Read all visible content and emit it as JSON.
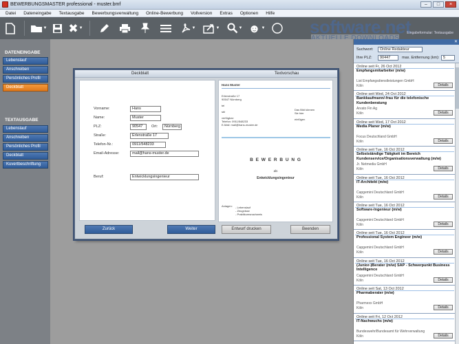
{
  "window": {
    "title": "BEWERBUNGSMASTER professional - muster.bmf"
  },
  "menu": [
    "Datei",
    "Dateneingabe",
    "Textausgabe",
    "Bewerbungsverwaltung",
    "Online-Bewerbung",
    "Vollversion",
    "Extras",
    "Optionen",
    "Hilfe"
  ],
  "watermark": {
    "big": "software.net",
    "small": "AKTUELLE DOWNLOADS",
    "sub": "Eingabeformular: Textausgabe"
  },
  "sidebar": {
    "section1": "DATENEINGABE",
    "items1": [
      "Lebenslauf",
      "Anschreiben",
      "Persönliches Profil",
      "Deckblatt"
    ],
    "section2": "TEXTAUSGABE",
    "items2": [
      "Lebenslauf",
      "Anschreiben",
      "Persönliches Profil",
      "Deckblatt",
      "Kuvertbeschriftung"
    ]
  },
  "dialog": {
    "tab_left": "Deckblatt",
    "tab_right": "Textvorschau",
    "fields": {
      "vorname_label": "Vorname:",
      "vorname": "Hans",
      "name_label": "Name:",
      "name": "Muster",
      "plz_label": "PLZ:",
      "plz": "90547",
      "ort_label": "Ort:",
      "ort": "Nürnberg",
      "strasse_label": "Straße:",
      "strasse": "Erlenstraße 17",
      "telefon_label": "Telefon-Nr.:",
      "telefon": "0911/548233",
      "email_label": "Email-Adresse:",
      "email": "mail@hans-muster.de",
      "beruf_label": "Beruf:",
      "beruf": "Entwicklungsingenieur"
    },
    "preview": {
      "name": "Hans Muster",
      "addr1": "Erlenstraße 17",
      "addr2": "90547 Nürnberg",
      "addr3": "tel",
      "addr4": "sbl",
      "addr5": "verfügbar:",
      "addr6": "Telefon: 0911/548233",
      "addr7": "E-Mail: mail@hans-muster.de",
      "photo1": "Das Bild können",
      "photo2": "Sie hier",
      "photo3": "einfügen",
      "title": "B E W E R B U N G",
      "als": "als",
      "job": "Entwicklungsingenieur",
      "anlagen": "Anlagen:",
      "anl1": "- Lebenslauf",
      "anl2": "- Zeugnisse",
      "anl3": "- Praktikumsnachweis"
    },
    "buttons": {
      "back": "Zurück",
      "next": "Weiter",
      "print": "Entwurf drucken",
      "close": "Beenden"
    }
  },
  "search": {
    "label1": "Suchwort:",
    "value1": "Online Redakteur",
    "label2": "Ihre PLZ:",
    "value2": "90447",
    "label3": "max. Entfernung (km):",
    "value3": "5"
  },
  "jobs": [
    {
      "date": "Online seit Fr, 26 Oct 2012",
      "title": "Empfangsmitarbeiter (m/w)",
      "company": "List Empfangsdienstleistungen GmbH",
      "loc": "Köln",
      "btn": "Details"
    },
    {
      "date": "Online seit Wed, 24 Oct 2012",
      "title": "Bankkaufmann/-frau für die telefonische Kundenberatung",
      "company": "Arvato Fin Ag",
      "loc": "Köln",
      "btn": "Details"
    },
    {
      "date": "Online seit Wed, 17 Oct 2012",
      "title": "Media Planer (m/w)",
      "company": "Focus Deutschland GmbH",
      "loc": "Köln",
      "btn": "Details"
    },
    {
      "date": "Online seit Tue, 16 Oct 2012",
      "title": "Selbstständige Tätigkeit im Bereich Kundenservice/Organisationsverwaltung (m/w)",
      "company": "Jr. Netmedia GmbH",
      "loc": "Köln",
      "btn": "Details"
    },
    {
      "date": "Online seit Tue, 16 Oct 2012",
      "title": "IT-Architekt (m/w)",
      "company": "Capgemini Deutschland GmbH",
      "loc": "Köln",
      "btn": "Details"
    },
    {
      "date": "Online seit Tue, 16 Oct 2012",
      "title": "Software-Ingenieur (m/w)",
      "company": "Capgemini Deutschland GmbH",
      "loc": "Köln",
      "btn": "Details"
    },
    {
      "date": "Online seit Tue, 16 Oct 2012",
      "title": "Professional System Engineer (m/w)",
      "company": "Capgemini Deutschland GmbH",
      "loc": "Köln",
      "btn": "Details"
    },
    {
      "date": "Online seit Tue, 16 Oct 2012",
      "title": "(Junior-)Berater (m/w) SAP - Schwerpunkt Business Intelligence",
      "company": "Capgemini Deutschland GmbH",
      "loc": "Köln",
      "btn": "Details"
    },
    {
      "date": "Online seit Sat, 13 Oct 2012",
      "title": "Pharmaberater (m/w)",
      "company": "Pharmexx GmbH",
      "loc": "Köln",
      "btn": "Details"
    },
    {
      "date": "Online seit Fri, 12 Oct 2012",
      "title": "IT-Nachwuchs (m/w)",
      "company": "Bundeswehr/Bundesamt für Wehrverwaltung",
      "loc": "Köln",
      "btn": "Details"
    }
  ]
}
